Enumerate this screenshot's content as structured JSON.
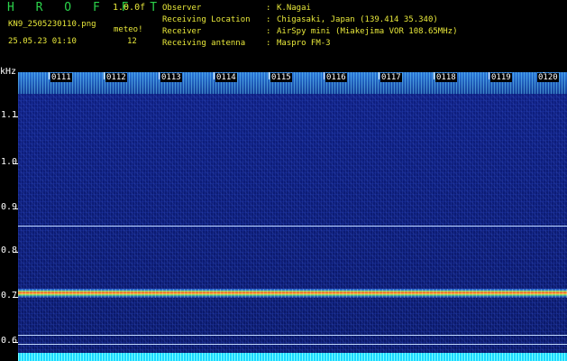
{
  "header": {
    "app_title": "H R O F F T",
    "version": "1.0.0f",
    "file_name": "KN9_2505230110.png",
    "mode_label": "meteo!",
    "datetime": "25.05.23 01:10",
    "count": "12"
  },
  "info": [
    {
      "key": "Observer",
      "value": "K.Nagai"
    },
    {
      "key": "Receiving Location",
      "value": "Chigasaki, Japan (139.414 35.340)"
    },
    {
      "key": "Receiver",
      "value": "AirSpy mini (Miakejima VOR 108.65MHz)"
    },
    {
      "key": "Receiving antenna",
      "value": "Maspro FM-3"
    }
  ],
  "plot": {
    "y_unit": "kHz",
    "y_labels": [
      "1.1",
      "1.0",
      "0.9",
      "0.8",
      "0.7",
      "0.6"
    ],
    "time_labels": [
      "0111",
      "0112",
      "0113",
      "0114",
      "0115",
      "0116",
      "0117",
      "0118",
      "0119",
      "0120"
    ]
  },
  "colors": {
    "header_text": "#e8e83a",
    "title": "#2bd24a",
    "background": "#0c1a6e"
  }
}
